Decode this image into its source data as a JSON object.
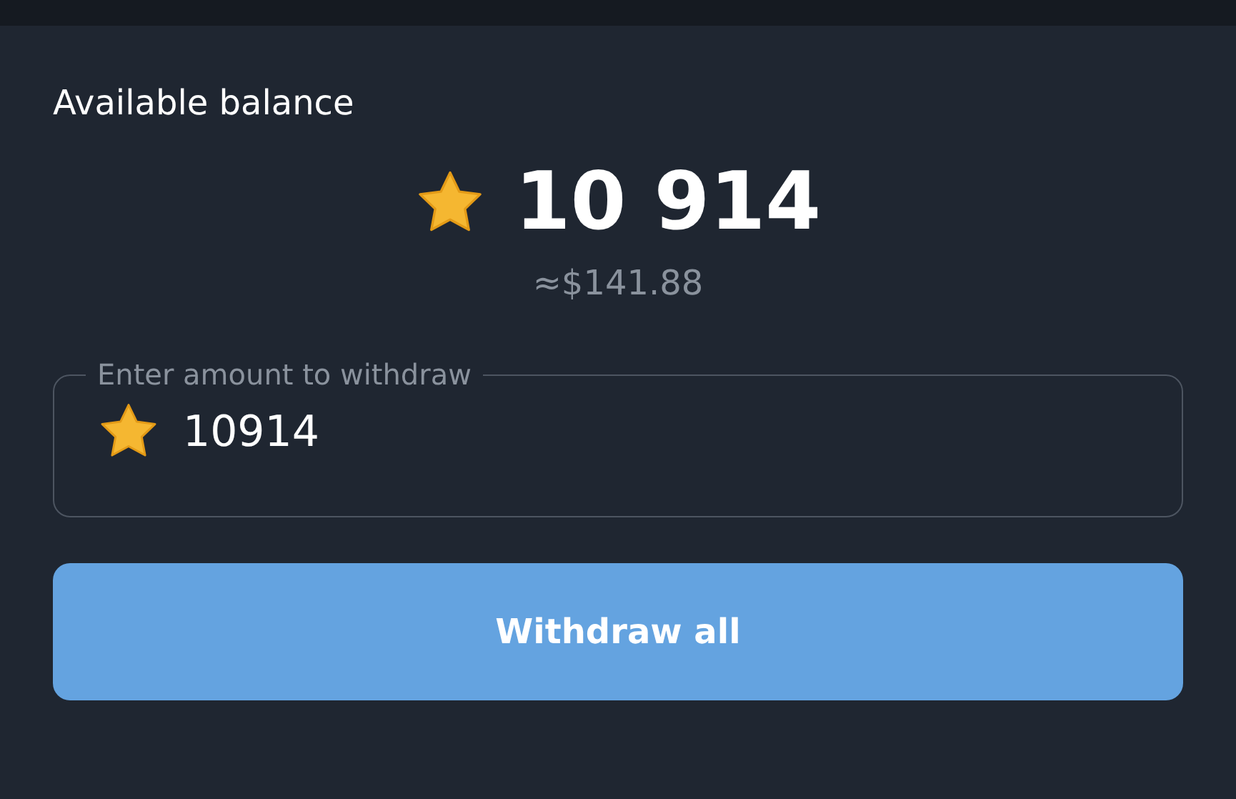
{
  "balance": {
    "title": "Available balance",
    "amount": "10 914",
    "usd": "≈$141.88"
  },
  "withdraw_field": {
    "label": "Enter amount to withdraw",
    "value": "10914"
  },
  "buttons": [
    {
      "label": "Withdraw all"
    }
  ]
}
